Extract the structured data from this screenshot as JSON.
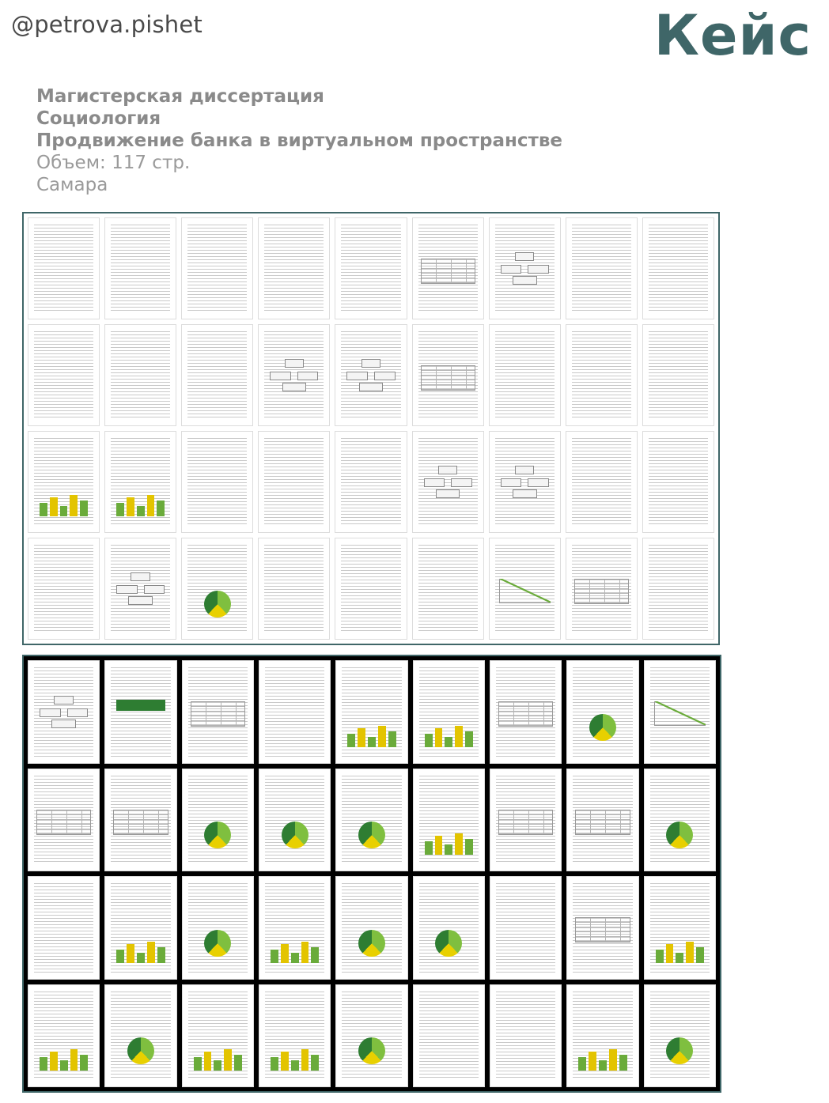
{
  "header": {
    "handle": "@petrova.pishet",
    "brand": "Кейс"
  },
  "info": {
    "degree": "Магистерская диссертация",
    "field": "Социология",
    "topic": "Продвижение банка в виртуальном пространстве",
    "volume": "Объем: 117 стр.",
    "city": "Самара"
  },
  "colors": {
    "accent": "#3f6668",
    "chart_green": "#6aab3a",
    "chart_yellow": "#e3c400",
    "chart_dark_green": "#2e7d32"
  },
  "spreads": [
    {
      "pages": 36,
      "figures": [
        "text",
        "text",
        "text",
        "text",
        "text",
        "table",
        "diagram",
        "text",
        "text",
        "text",
        "text",
        "text",
        "diagram",
        "diagram",
        "table",
        "text",
        "text",
        "text",
        "bars",
        "bars",
        "text",
        "text",
        "text",
        "diagram",
        "diagram",
        "text",
        "text",
        "text",
        "diagram",
        "pie",
        "text",
        "text",
        "text",
        "line",
        "table",
        "text"
      ]
    },
    {
      "pages": 36,
      "figures": [
        "diagram",
        "logo",
        "table",
        "text",
        "bars",
        "bars",
        "table",
        "pie",
        "line",
        "table",
        "table",
        "pie",
        "pie",
        "pie",
        "bars",
        "table",
        "table",
        "pie",
        "text",
        "bars",
        "pie",
        "bars",
        "pie",
        "pie",
        "text",
        "table",
        "bars",
        "bars",
        "pie",
        "bars",
        "bars",
        "pie",
        "text",
        "text",
        "bars",
        "pie"
      ]
    }
  ]
}
